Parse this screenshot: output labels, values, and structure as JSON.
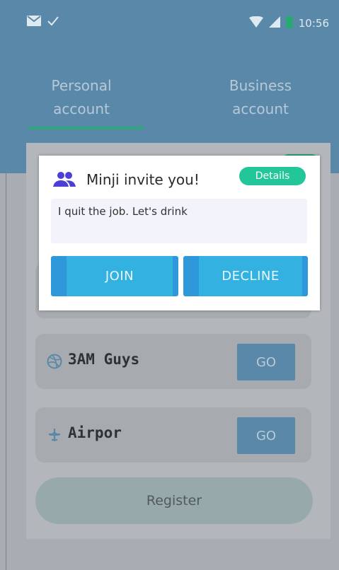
{
  "status_bar": {
    "time": "10:56",
    "icons": [
      "mail-icon",
      "check-icon",
      "wifi-icon",
      "signal-icon",
      "battery-icon"
    ]
  },
  "tabs": [
    {
      "label_line1": "Personal",
      "label_line2": "account",
      "active": true
    },
    {
      "label_line1": "Business",
      "label_line2": "account",
      "active": false
    }
  ],
  "colors": {
    "header": "#5a88a8",
    "tab_indicator": "#2fa57b",
    "details_button": "#23c698",
    "dialog_button": "#33b2e2",
    "invite_icon": "#4b3fd6"
  },
  "dialog": {
    "title": "Minji invite you!",
    "details_label": "Details",
    "message": "I quit the job. Let's drink",
    "join_label": "JOIN",
    "decline_label": "DECLINE"
  },
  "rooms": [
    {
      "name": "3AM Guys",
      "icon": "dribbble-icon",
      "go_label": "GO"
    },
    {
      "name": "Airpor",
      "icon": "airplane-icon",
      "go_label": "GO"
    }
  ],
  "register_label": "Register"
}
